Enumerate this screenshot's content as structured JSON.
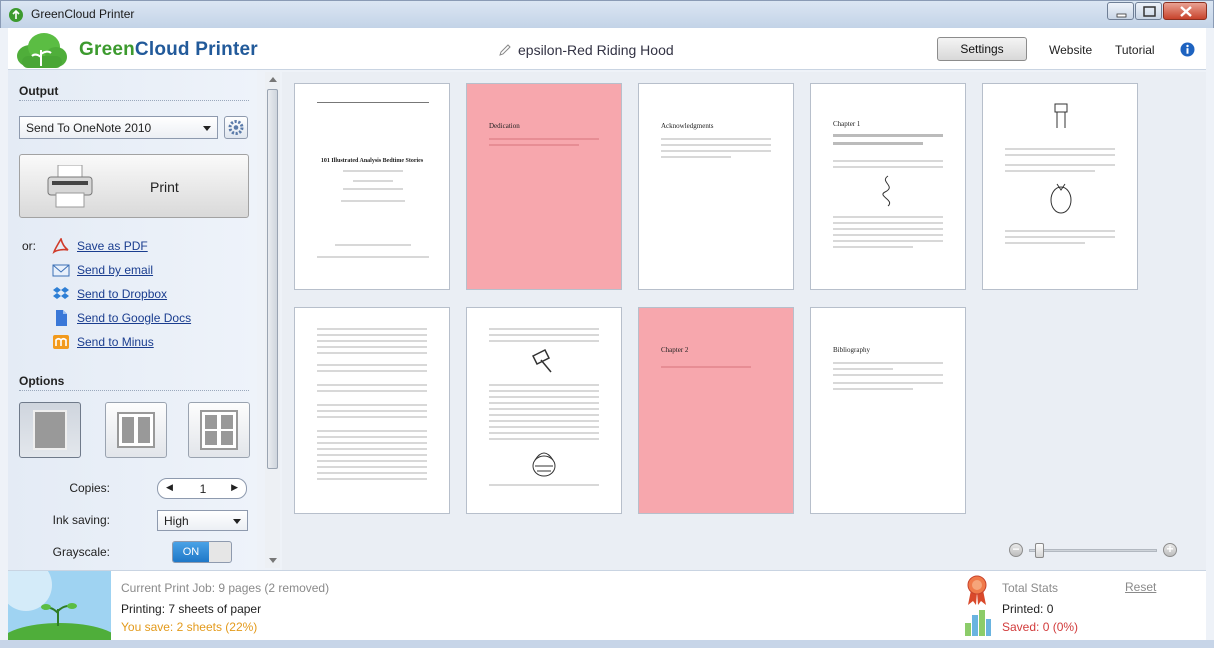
{
  "window": {
    "title": "GreenCloud Printer"
  },
  "header": {
    "brand_green": "Green",
    "brand_blue": "Cloud Printer",
    "doc_title": "epsilon-Red Riding Hood",
    "settings_label": "Settings",
    "website_label": "Website",
    "tutorial_label": "Tutorial"
  },
  "output": {
    "section_title": "Output",
    "printer": "Send To OneNote 2010",
    "print_label": "Print",
    "or_label": "or:",
    "alternatives": [
      {
        "label": "Save as PDF",
        "icon": "pdf-icon"
      },
      {
        "label": "Send by email",
        "icon": "email-icon"
      },
      {
        "label": "Send to Dropbox",
        "icon": "dropbox-icon"
      },
      {
        "label": "Send to Google Docs",
        "icon": "google-docs-icon"
      },
      {
        "label": "Send to Minus",
        "icon": "minus-icon"
      }
    ]
  },
  "options": {
    "section_title": "Options",
    "copies_label": "Copies:",
    "copies_value": "1",
    "ink_label": "Ink saving:",
    "ink_value": "High",
    "grayscale_label": "Grayscale:",
    "grayscale_value": "ON"
  },
  "pages": [
    {
      "title": "101 Illustrated Analysis Bedtime Stories",
      "removed": false
    },
    {
      "title": "Dedication",
      "removed": true
    },
    {
      "title": "Acknowledgments",
      "removed": false
    },
    {
      "title": "Chapter 1",
      "removed": false
    },
    {
      "title": "",
      "removed": false
    },
    {
      "title": "",
      "removed": false
    },
    {
      "title": "",
      "removed": false
    },
    {
      "title": "Chapter 2",
      "removed": true
    },
    {
      "title": "Bibliography",
      "removed": false
    }
  ],
  "footer": {
    "current_job": "Current Print Job: 9 pages (2 removed)",
    "printing": "Printing: 7 sheets of paper",
    "you_save": "You save: 2 sheets (22%)",
    "total_stats": "Total Stats",
    "reset": "Reset",
    "printed": "Printed: 0",
    "saved": "Saved: 0 (0%)"
  },
  "colors": {
    "brand_green": "#3c9a2e",
    "brand_blue": "#225a9a",
    "save_orange": "#e39a1b",
    "saved_red": "#d23c3c",
    "removed_page": "#f7a7ad"
  }
}
